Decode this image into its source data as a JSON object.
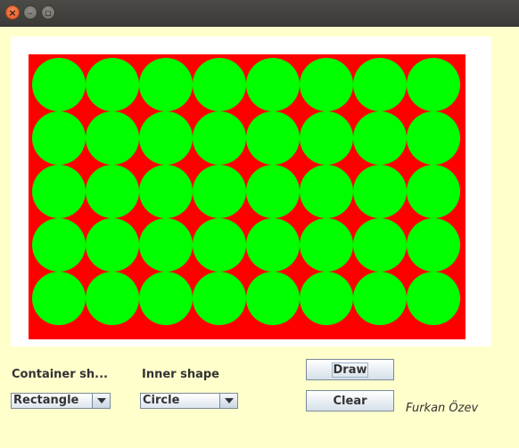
{
  "window": {
    "buttons": [
      "close",
      "minimize",
      "maximize"
    ]
  },
  "canvas": {
    "container_shape": "Rectangle",
    "inner_shape": "Circle",
    "container_color": "#ff0000",
    "inner_color": "#00ff00",
    "background_color": "#ffffff",
    "rows": 5,
    "columns": 8
  },
  "controls": {
    "container_label": "Container sh...",
    "inner_label": "Inner shape",
    "container_select": {
      "selected": "Rectangle"
    },
    "inner_select": {
      "selected": "Circle"
    },
    "draw_label": "Draw",
    "clear_label": "Clear"
  },
  "author": "Furkan Özev",
  "icons": {
    "close": "close-icon",
    "minimize": "minimize-icon",
    "maximize": "maximize-icon",
    "dropdown": "chevron-down-icon"
  }
}
